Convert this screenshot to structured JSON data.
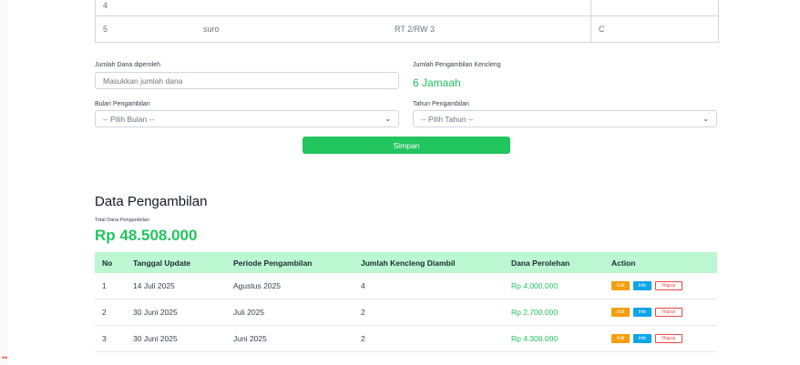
{
  "top_table": {
    "rows": [
      {
        "no": "4",
        "name": "",
        "rt_rw": "",
        "extra": ""
      },
      {
        "no": "5",
        "name": "suro",
        "rt_rw": "RT 2/RW 3",
        "extra": "C"
      }
    ]
  },
  "form": {
    "dana_label": "Jumlah Dana diperoleh",
    "dana_placeholder": "Masukkan jumlah dana",
    "kencleng_label": "Jumlah Pengambilan Kencleng",
    "kencleng_value": "6 Jamaah",
    "bulan_label": "Bulan Pengambilan",
    "bulan_selected": "-- Pilih Bulan --",
    "tahun_label": "Tahun Pengambilan",
    "tahun_selected": "-- Pilih Tahun --",
    "save_label": "Simpan"
  },
  "section": {
    "title": "Data Pengambilan",
    "total_label": "Total Dana Pengambilan",
    "total_value": "Rp 48.508.000"
  },
  "table": {
    "headers": [
      "No",
      "Tanggal Update",
      "Periode Pengambilan",
      "Jumlah Kencleng Diambil",
      "Dana Perolehan",
      "Action"
    ],
    "rows": [
      {
        "no": "1",
        "tanggal": "14 Juli 2025",
        "periode": "Agustus 2025",
        "jumlah": "4",
        "dana": "Rp 4.000.000"
      },
      {
        "no": "2",
        "tanggal": "30 Juni 2025",
        "periode": "Juli 2025",
        "jumlah": "2",
        "dana": "Rp 2.700.000"
      },
      {
        "no": "3",
        "tanggal": "30 Juni 2025",
        "periode": "Juni 2025",
        "jumlah": "2",
        "dana": "Rp 4.300.000"
      }
    ],
    "action_labels": {
      "edit": "Edit",
      "info": "Info",
      "delete": "Hapus"
    }
  },
  "colors": {
    "accent": "#22c55e",
    "header_bg": "#bbf7d0",
    "warning": "#f59e0b",
    "info": "#0ea5e9",
    "danger": "#ef4444"
  },
  "icons": {
    "select_arrow": "chevron-down-icon"
  }
}
